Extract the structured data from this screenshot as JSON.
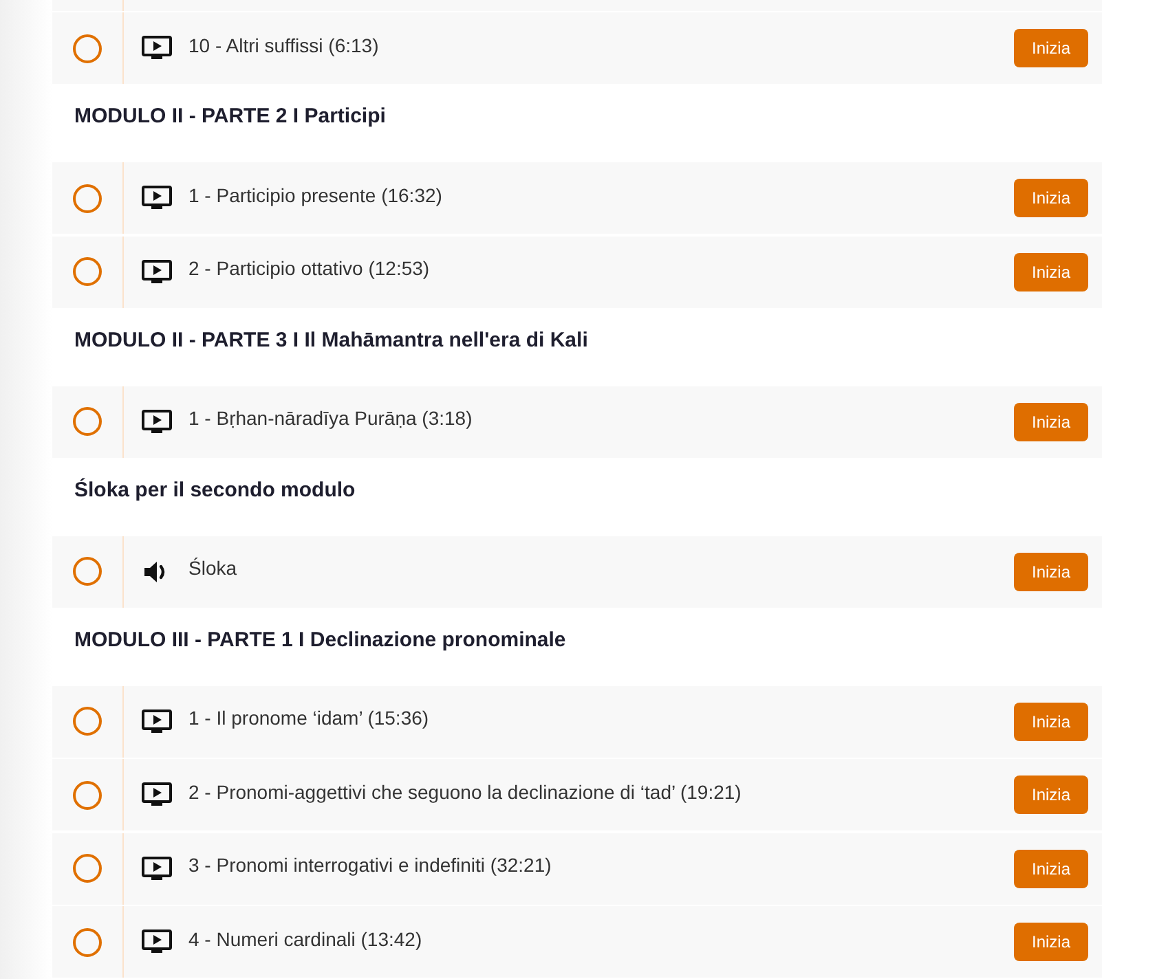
{
  "sections": [
    {
      "lessons": [
        {
          "kind": "video",
          "title": "10 - Altri suffissi (6:13)",
          "completed": false,
          "button": "Inizia"
        }
      ]
    },
    {
      "title": "MODULO II - PARTE 2 I Participi",
      "lessons": [
        {
          "kind": "video",
          "title": "1 - Participio presente (16:32)",
          "completed": false,
          "button": "Inizia"
        },
        {
          "kind": "video",
          "title": "2 - Participio ottativo (12:53)",
          "completed": false,
          "button": "Inizia"
        }
      ]
    },
    {
      "title": "MODULO II - PARTE 3 I Il Mahāmantra nell'era di Kali",
      "lessons": [
        {
          "kind": "video",
          "title": "1 - Bṛhan-nāradīya Purāṇa (3:18)",
          "completed": false,
          "button": "Inizia"
        }
      ]
    },
    {
      "title": "Śloka per il secondo modulo",
      "lessons": [
        {
          "kind": "audio",
          "title": "Śloka",
          "completed": false,
          "button": "Inizia"
        }
      ]
    },
    {
      "title": "MODULO III - PARTE 1 I Declinazione pronominale",
      "lessons": [
        {
          "kind": "video",
          "title": "1 - Il pronome ‘idam’ (15:36)",
          "completed": false,
          "button": "Inizia"
        },
        {
          "kind": "video",
          "title": "2 - Pronomi-aggettivi che seguono la declinazione di ‘tad’ (19:21)",
          "completed": false,
          "button": "Inizia"
        },
        {
          "kind": "video",
          "title": "3 - Pronomi interrogativi e indefiniti (32:21)",
          "completed": false,
          "button": "Inizia"
        },
        {
          "kind": "video",
          "title": "4 - Numeri cardinali (13:42)",
          "completed": false,
          "button": "Inizia"
        }
      ]
    }
  ]
}
